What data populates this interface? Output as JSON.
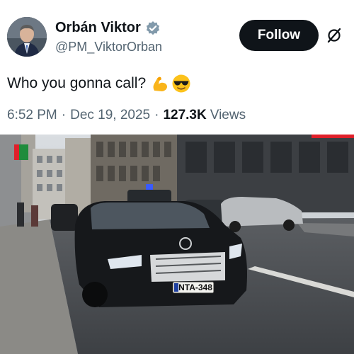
{
  "post": {
    "author": {
      "name": "Orbán Viktor",
      "handle": "@PM_ViktorOrban",
      "verified_icon": "verified-badge-icon",
      "badge_color": "#829aab"
    },
    "follow_label": "Follow",
    "text": "Who you gonna call?",
    "emojis": [
      "flexed-biceps-emoji",
      "sunglasses-face-emoji"
    ],
    "time": "6:52 PM",
    "separator": "·",
    "date": "Dec 19, 2025",
    "views_count": "127.3K",
    "views_label": "Views"
  },
  "media": {
    "license_plate": "NTA-348",
    "accent_color": "#e0202a"
  }
}
